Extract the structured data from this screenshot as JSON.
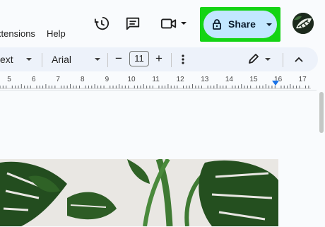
{
  "menu": {
    "extensions_label": "xtensions",
    "help_label": "Help"
  },
  "header_icons": [
    "history-icon",
    "comment-icon",
    "video-call-icon"
  ],
  "share": {
    "label": "Share",
    "highlight_color": "#14d414",
    "button_color": "#c2e7ff"
  },
  "toolbar": {
    "style_label": "ext",
    "font_label": "Arial",
    "font_size_value": "11",
    "minus_label": "−",
    "plus_label": "+"
  },
  "ruler": {
    "labels": [
      "5",
      "6",
      "7",
      "8",
      "9",
      "10",
      "11",
      "12",
      "13",
      "14",
      "15",
      "16",
      "17"
    ]
  }
}
